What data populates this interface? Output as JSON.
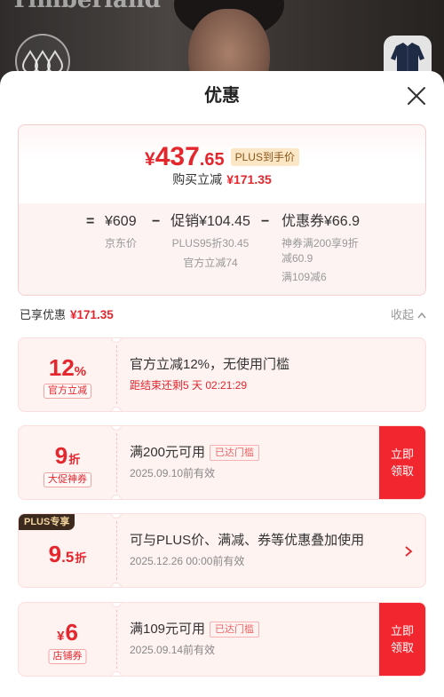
{
  "background": {
    "logo_text": "Timberland",
    "left_icon": "water-drops-icon",
    "thumbnail_icon": "jacket-icon"
  },
  "sheet": {
    "title": "优惠",
    "close_icon": "close-icon"
  },
  "price_card": {
    "currency": "¥",
    "price_integer": "437",
    "price_decimal": ".65",
    "price_badge": "PLUS到手价",
    "saving_label": "购买立减",
    "saving_value": "¥171.35",
    "breakdown": {
      "equals": "=",
      "minus": "−",
      "jd_price": "¥609",
      "jd_price_label": "京东价",
      "promotion": "促销¥104.45",
      "promotion_details": [
        "PLUS95折30.45",
        "官方立减74"
      ],
      "coupon": "优惠券¥66.9",
      "coupon_details": [
        "神券满200享9折",
        "减60.9",
        "满109减6"
      ]
    }
  },
  "summary": {
    "label": "已享优惠",
    "value": "¥171.35",
    "collapse_label": "收起",
    "collapse_icon": "chevron-up-icon"
  },
  "coupons": [
    {
      "value": "12",
      "unit": "%",
      "tag": "官方立减",
      "title": "官方立减12%，无使用门槛",
      "subtitle": "距结束还剩5 天 02:21:29"
    },
    {
      "value": "9",
      "unit": "折",
      "tag": "大促神券",
      "title": "满200元可用",
      "status_badge": "已达门槛",
      "subtitle": "2025.09.10前有效",
      "action_lines": [
        "立即",
        "领取"
      ]
    },
    {
      "corner_tag": "PLUS专享",
      "value": "9",
      "value_decimal": ".5",
      "unit": "折",
      "title": "可与PLUS价、满减、券等优惠叠加使用",
      "subtitle": "2025.12.26 00:00前有效",
      "action_icon": "chevron-right-icon"
    },
    {
      "prefix": "¥",
      "value": "6",
      "tag": "店铺券",
      "title": "满109元可用",
      "status_badge": "已达门槛",
      "subtitle": "2025.09.14前有效",
      "action_lines": [
        "立即",
        "领取"
      ]
    }
  ],
  "colors": {
    "accent_red": "#e4262d",
    "action_red": "#f2262e",
    "card_pink": "#fff3f2",
    "plus_badge_bg": "#fbe7c6",
    "plus_tag_bg": "#3c2a1f",
    "plus_tag_text": "#f2d39c"
  }
}
